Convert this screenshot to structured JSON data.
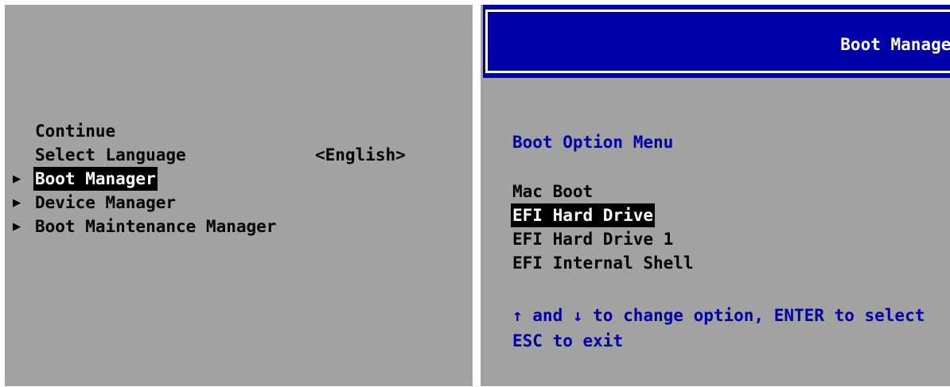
{
  "setup_menu": {
    "items": [
      {
        "label": "Continue",
        "has_arrow": false,
        "selected": false
      },
      {
        "label": "Select Language",
        "has_arrow": false,
        "selected": false,
        "value": "<English>"
      },
      {
        "label": "Boot Manager",
        "has_arrow": true,
        "selected": true
      },
      {
        "label": "Device Manager",
        "has_arrow": true,
        "selected": false
      },
      {
        "label": "Boot Maintenance Manager",
        "has_arrow": true,
        "selected": false
      }
    ],
    "arrow_glyph": "▶"
  },
  "boot_manager": {
    "title": "Boot Manager",
    "subtitle": "Boot Option Menu",
    "options": [
      {
        "label": "Mac Boot",
        "selected": false
      },
      {
        "label": "EFI Hard Drive",
        "selected": true
      },
      {
        "label": "EFI Hard Drive 1",
        "selected": false
      },
      {
        "label": "EFI Internal Shell",
        "selected": false
      }
    ],
    "help_line_1": "↑ and ↓ to change option, ENTER to select",
    "help_line_2": "ESC to exit"
  },
  "colors": {
    "panel_bg": "#a2a2a2",
    "title_bar": "#0000a8",
    "highlight_bg": "#000000",
    "highlight_fg": "#ffffff",
    "blue_text": "#0000a8"
  }
}
